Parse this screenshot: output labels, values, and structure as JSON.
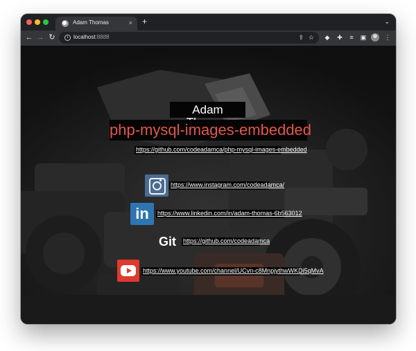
{
  "browser": {
    "tab_title": "Adam Thomas",
    "tab_close": "×",
    "new_tab": "+",
    "tab_menu": "⌄",
    "url_host": "localhost",
    "url_port": ":8888",
    "icons": {
      "back": "arrow-left-icon",
      "forward": "arrow-right-icon",
      "reload": "reload-icon",
      "site_info": "info-icon",
      "share": "share-icon",
      "bookmark": "star-icon",
      "extension_1": "extension-icon",
      "extensions": "puzzle-icon",
      "reading_list": "reading-list-icon",
      "side_panel": "side-panel-icon",
      "profile": "avatar",
      "menu": "kebab-menu-icon"
    },
    "glyphs": {
      "back": "←",
      "forward": "→",
      "reload": "↻",
      "info": "i",
      "share": "⇪",
      "star": "☆",
      "ext1": "◆",
      "ext2": "✚",
      "ext3": "≡",
      "side_panel": "▣",
      "kebab": "⋮"
    }
  },
  "page": {
    "name": "Adam Thomas",
    "project": "php-mysql-images-embedded",
    "repo_link": "https://github.com/codeadamca/php-mysql-images-embedded",
    "instagram_link": "https://www.instagram.com/codeadamca/",
    "linkedin_logo_text": "in",
    "linkedin_link": "https://www.linkedin.com/in/adam-thomas-6b563012",
    "git_logo_text": "Git",
    "github_link": "https://github.com/codeadamca",
    "youtube_link": "https://www.youtube.com/channel/UCvn-c8MnpjythwWKDi5qMvA",
    "colors": {
      "project_title": "#e2564a",
      "instagram": "#4a6b92",
      "linkedin": "#2d76b2",
      "youtube": "#e03a2e"
    }
  }
}
